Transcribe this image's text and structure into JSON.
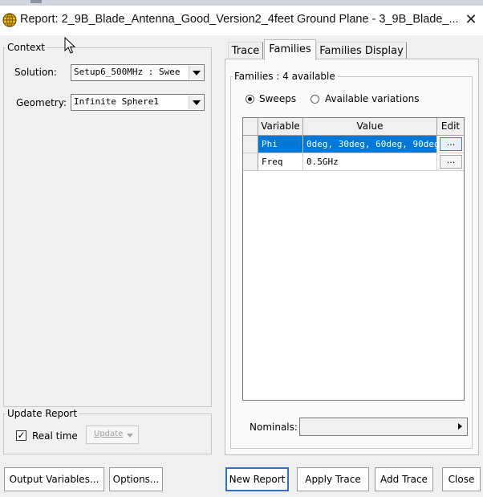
{
  "window": {
    "title": "Report: 2_9B_Blade_Antenna_Good_Version2_4feet Ground Plane - 3_9B_Blade_...",
    "close_glyph": "✕",
    "app_icon": "globe-crosshair-icon"
  },
  "context": {
    "group_label": "Context",
    "solution_label": "Solution:",
    "solution_value": "Setup6_500MHz : Swee",
    "geometry_label": "Geometry:",
    "geometry_value": "Infinite Sphere1"
  },
  "update_report": {
    "group_label": "Update Report",
    "realtime_label": "Real time",
    "realtime_checked": true,
    "update_label": "Update"
  },
  "tabs": [
    {
      "label": "Trace",
      "active": false
    },
    {
      "label": "Families",
      "active": true
    },
    {
      "label": "Families Display",
      "active": false
    }
  ],
  "families": {
    "group_label": "Families : 4 available",
    "radio_sweeps": "Sweeps",
    "radio_variations": "Available variations",
    "selected_mode": "Sweeps",
    "columns": [
      "Variable",
      "Value",
      "Edit"
    ],
    "rows": [
      {
        "variable": "Phi",
        "value": "0deg, 30deg, 60deg, 90deg",
        "edit": "...",
        "selected": true
      },
      {
        "variable": "Freq",
        "value": "0.5GHz",
        "edit": "...",
        "selected": false
      }
    ],
    "nominals_label": "Nominals:",
    "nominals_value": ""
  },
  "buttons": {
    "output_variables": "Output Variables...",
    "options": "Options...",
    "new_report": "New Report",
    "apply_trace": "Apply Trace",
    "add_trace": "Add Trace",
    "close": "Close"
  },
  "colors": {
    "selection": "#0078d7",
    "dialog_bg": "#f0f0f0",
    "default_button_border": "#2f6fcf"
  }
}
